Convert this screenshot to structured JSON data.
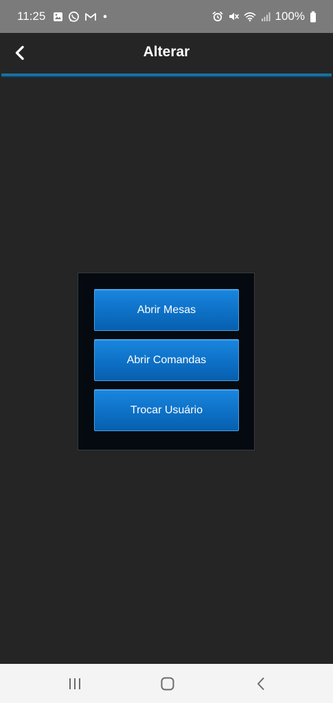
{
  "status_bar": {
    "time": "11:25",
    "battery_percent": "100%",
    "notification_icons": [
      "image-icon",
      "whatsapp-icon",
      "gmail-icon",
      "dot-icon"
    ],
    "system_icons": [
      "alarm-icon",
      "mute-icon",
      "wifi-icon",
      "signal-icon",
      "battery-icon"
    ]
  },
  "header": {
    "title": "Alterar",
    "back_icon": "chevron-left-icon"
  },
  "menu": {
    "buttons": [
      {
        "label": "Abrir Mesas"
      },
      {
        "label": "Abrir Comandas"
      },
      {
        "label": "Trocar Usuário"
      }
    ]
  },
  "navigation_bar": {
    "icons": [
      "recents-icon",
      "home-icon",
      "back-icon"
    ]
  },
  "colors": {
    "background": "#252525",
    "status_bar": "#7b7b7b",
    "accent": "#1c6f9e",
    "button": "#0e72c8",
    "panel": "#040a10",
    "nav_bar": "#f4f4f4"
  }
}
